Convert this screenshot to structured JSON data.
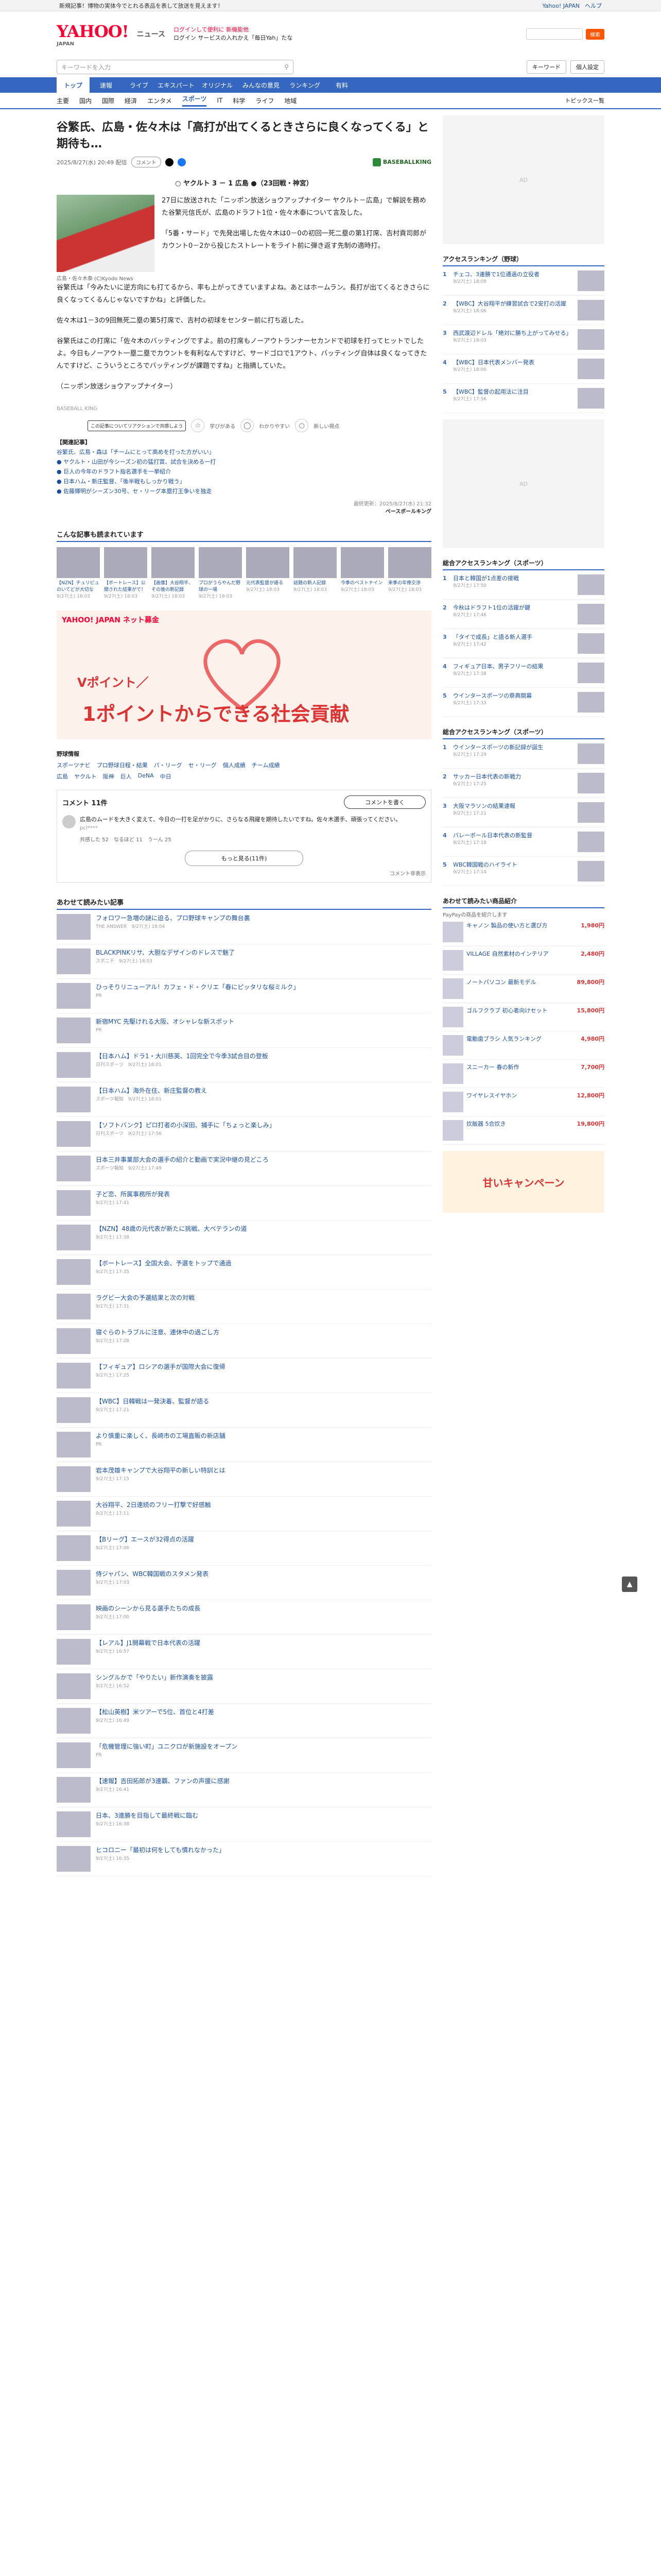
{
  "topstrip": {
    "promo": "新規記事！博物の実体今でとれる表品を表して放送を見えます！",
    "links": [
      "Yahoo! JAPAN",
      "ヘルプ"
    ]
  },
  "header": {
    "logo": "YAHOO!",
    "logo_sub": "JAPAN",
    "service": "ニュース",
    "lines": [
      "ログインして便利に 新機能他",
      "ログイン サービスの入れかえ「毎日Yah」たな"
    ],
    "search_btn": "検索"
  },
  "search": {
    "placeholder": "キーワードを入力",
    "right": [
      "キーワード",
      "個人設定"
    ]
  },
  "nav": [
    "トップ",
    "速報",
    "ライブ",
    "エキスパート",
    "オリジナル",
    "みんなの意見",
    "ランキング",
    "有料"
  ],
  "nav_on": "トップ",
  "subnav": [
    "主要",
    "国内",
    "国際",
    "経済",
    "エンタメ",
    "スポーツ",
    "IT",
    "科学",
    "ライフ",
    "地域"
  ],
  "subnav_on": "スポーツ",
  "subnav_topics": "トピックス一覧",
  "article": {
    "title": "谷繁氏、広島・佐々木は「高打が出てくるときさらに良くなってくる」と期待も…",
    "date": "2025/8/27(水) 20:49 配信",
    "comments_btn": "コメント",
    "brand": "BASEBALLKING",
    "lead": "○ ヤクルト 3 － 1 広島 ●（23回戦・神宮）",
    "caption": "広島・佐々木泰 (C)Kyodo News",
    "paragraphs": [
      "27日に放送された「ニッポン放送ショウアップナイター ヤクルト－広島」で解説を務めた谷繁元信氏が、広島のドラフト1位・佐々木泰について言及した。",
      "「5番・サード」で先発出場した佐々木は0－0の初回一死二塁の第1打席、吉村貢司郎がカウント0－2から投じたストレートをライト前に弾き返す先制の適時打。",
      "谷繁氏は「今みたいに逆方向にも打てるから、率も上がってきていますよね。あとはホームラン。長打が出てくるときさらに良くなってくるんじゃないですかね」と評価した。",
      "佐々木は1－3の9回無死二塁の第5打席で、吉村の初球をセンター前に打ち返した。",
      "谷繁氏はこの打席に「佐々木のバッティングですよ。前の打席もノーアウトランナーセカンドで初球を打ってヒットでしたよ。今日もノーアウト一塁二塁でカウントを有利なんですけど、サードゴロで1アウト、バッティング自体は良くなってきたんですけど、こういうところでバッティングが課題ですね」と指摘していた。"
    ],
    "source": "（ニッポン放送ショウアップナイター）",
    "provider": "BASEBALL KING",
    "tip": "この記事についてリアクションで共感しよう",
    "reactions": [
      "学びがある",
      "わかりやすい",
      "新しい視点"
    ],
    "related_hd": "【関連記事】",
    "related": [
      "谷繁氏、広島・森は「チームにとって高めを打った方がいい」",
      "● ヤクルト・山田が今シーズン初の猛打賞、試合を決める一打",
      "● 巨人の今年のドラフト指名選手を一挙紹介",
      "● 日本ハム・新庄監督、「後半戦もしっかり戦う」",
      "● 佐藤輝明がシーズン30号、セ・リーグ本塁打王争いを独走"
    ],
    "credit_date": "最終更新：2025/8/27(水) 21:32",
    "credit_name": "ベースボールキング"
  },
  "recommend": {
    "title": "こんな記事も読まれています",
    "cards": [
      {
        "t": "【NZN】チュリピュのいてどが大切な",
        "s": "9/27(土) 18:03"
      },
      {
        "t": "【ボートレース】公開された結果がで！",
        "s": "9/27(土) 18:03"
      },
      {
        "t": "【画像】大谷翔平、その後の新記録",
        "s": "9/27(土) 18:03"
      },
      {
        "t": "プロがうらやんだ野球の一場",
        "s": "9/27(土) 18:03"
      },
      {
        "t": "元代表監督が語る",
        "s": "9/27(土) 18:03"
      },
      {
        "t": "話題の新人記録",
        "s": "9/27(土) 18:03"
      },
      {
        "t": "今季のベストナイン",
        "s": "9/27(土) 18:03"
      },
      {
        "t": "来季の年俸交渉",
        "s": "9/27(土) 18:03"
      }
    ]
  },
  "banner": {
    "top": "YAHOO! JAPAN ネット募金",
    "line1": "Vポイント／",
    "line2": "1ポイントからできる社会貢献"
  },
  "schedule": {
    "title": "野球情報",
    "row1": [
      "スポーツナビ",
      "プロ野球日程・結果",
      "パ・リーグ",
      "セ・リーグ",
      "個人成績",
      "チーム成績"
    ],
    "row2": [
      "広島",
      "ヤクルト",
      "阪神",
      "巨人",
      "DeNA",
      "中日"
    ]
  },
  "comments": {
    "title": "コメント 11件",
    "write": "コメントを書く",
    "first": "広島のムードを大きく変えて、今日の一打を足がかりに、さらなる飛躍を期待したいですね。佐々木選手、頑張ってください。",
    "first_user": "pcl****",
    "votes": [
      "共感した 52",
      "なるほど 11",
      "うーん 25"
    ],
    "more": "もっと見る(11件)",
    "note": "コメント非表示"
  },
  "feed_title": "あわせて読みたい記事",
  "feed": [
    {
      "t": "フォロワー急増の謎に迫る、プロ野球キャンプの舞台裏",
      "s": "THE ANSWER　9/27(土) 18:04"
    },
    {
      "t": "BLACKPINKリサ、大胆なデザインのドレスで魅了",
      "s": "スポニチ　9/27(土) 18:03"
    },
    {
      "t": "ひっそりリニューアル！カフェ・ド・クリエ「春にピッタリな桜ミルク」",
      "s": "PR"
    },
    {
      "t": "新宿MYC 先駆けれる大阪、オシャレな新スポット",
      "s": "PR"
    },
    {
      "t": "【日本ハム】ドラ1・大川慈英、1回完全で今季3試合目の登板",
      "s": "日刊スポーツ　9/27(土) 18:01"
    },
    {
      "t": "【日本ハム】海外在住、新庄監督の教え",
      "s": "スポーツ報知　9/27(土) 18:01"
    },
    {
      "t": "【ソフトバンク】ピロ打者の小深田、捕手に「ちょっと楽しみ」",
      "s": "日刊スポーツ　9/27(土) 17:56"
    },
    {
      "t": "日本三井事業部大会の選手の紹介と動画で実況中継の見どころ",
      "s": "スポーツ報知　9/27(土) 17:49"
    },
    {
      "t": "子ど恋、所属事務所が発表",
      "s": "9/27(土) 17:41"
    },
    {
      "t": "【NZN】48歳の元代表が新たに挑戦、大ベテランの道",
      "s": "9/27(土) 17:38"
    },
    {
      "t": "【ボートレース】全国大会、予選をトップで通過",
      "s": "9/27(土) 17:35"
    },
    {
      "t": "ラグビー大会の予選結果と次の対戦",
      "s": "9/27(土) 17:31"
    },
    {
      "t": "寝ぐらのトラブルに注意、連休中の過ごし方",
      "s": "9/27(土) 17:28"
    },
    {
      "t": "【フィギュア】ロシアの選手が国際大会に復帰",
      "s": "9/27(土) 17:25"
    },
    {
      "t": "【WBC】日韓戦は一発決着、監督が語る",
      "s": "9/27(土) 17:21"
    },
    {
      "t": "より慎重に楽しく、長崎市の工場直販の新店舗",
      "s": "PR"
    },
    {
      "t": "岩本茂雄キャンプで大谷翔平の新しい特訓とは",
      "s": "9/27(土) 17:15"
    },
    {
      "t": "大谷翔平、2日連続のフリー打撃で好感触",
      "s": "9/27(土) 17:11"
    },
    {
      "t": "【Bリーグ】エースが32得点の活躍",
      "s": "9/27(土) 17:06"
    },
    {
      "t": "侍ジャパン、WBC韓国戦のスタメン発表",
      "s": "9/27(土) 17:03"
    },
    {
      "t": "映画のシーンから見る選手たちの成長",
      "s": "9/27(土) 17:00"
    },
    {
      "t": "【レアル】J1開幕戦で日本代表の活躍",
      "s": "9/27(土) 16:57"
    },
    {
      "t": "シングルかで「やりたい」新作演奏を披露",
      "s": "9/27(土) 16:52"
    },
    {
      "t": "【松山英樹】米ツアーで5位、首位と4打差",
      "s": "9/27(土) 16:49"
    },
    {
      "t": "「危機管理に強い町」ユニクロが新施設をオープン",
      "s": "PR"
    },
    {
      "t": "【速報】吉田拓郎が3連覇、ファンの声援に感謝",
      "s": "9/27(土) 16:41"
    },
    {
      "t": "日本、3連勝を目指して最終戦に臨む",
      "s": "9/27(土) 16:38"
    },
    {
      "t": "ヒコロニー「最初は何をしても慣れなかった」",
      "s": "9/27(土) 16:35"
    }
  ],
  "side": {
    "rank_title": "アクセスランキング（野球）",
    "rank": [
      {
        "t": "チェコ、3連勝で1位通過の立役者",
        "s": "9/27(土) 18:09"
      },
      {
        "t": "【WBC】大谷翔平が練習試合で2安打の活躍",
        "s": "9/27(土) 18:06"
      },
      {
        "t": "西武渡辺ドレル「絶対に勝ち上がってみせる」",
        "s": "9/27(土) 18:03"
      },
      {
        "t": "【WBC】日本代表メンバー発表",
        "s": "9/27(土) 18:00"
      },
      {
        "t": "【WBC】監督の起用法に注目",
        "s": "9/27(土) 17:56"
      }
    ],
    "rank2_title": "総合アクセスランキング（スポーツ）",
    "rank2": [
      {
        "t": "日本と韓国が1点差の接戦",
        "s": "9/27(土) 17:50"
      },
      {
        "t": "今秋はドラフト1位の活躍が鍵",
        "s": "9/27(土) 17:46"
      },
      {
        "t": "「タイで成長」と語る新人選手",
        "s": "9/27(土) 17:42"
      },
      {
        "t": "フィギュア日本、男子フリーの結果",
        "s": "9/27(土) 17:38"
      },
      {
        "t": "ウインタースポーツの祭典開幕",
        "s": "9/27(土) 17:33"
      }
    ],
    "rank3_title": "総合アクセスランキング（スポーツ）",
    "rank3": [
      {
        "t": "ウインタースポーツの新記録が誕生",
        "s": "9/27(土) 17:29"
      },
      {
        "t": "サッカー日本代表の新戦力",
        "s": "9/27(土) 17:25"
      },
      {
        "t": "大阪マラソンの結果速報",
        "s": "9/27(土) 17:21"
      },
      {
        "t": "バレーボール日本代表の新監督",
        "s": "9/27(土) 17:18"
      },
      {
        "t": "WBC韓国戦のハイライト",
        "s": "9/27(土) 17:14"
      }
    ],
    "shop_title": "あわせて読みたい商品紹介",
    "shop_sub": "PayPayの商品を紹介します",
    "shop": [
      {
        "t": "キャノン 製品の使い方と選び方",
        "p": "1,980円"
      },
      {
        "t": "VILLAGE 自然素材のインテリア",
        "p": "2,480円"
      },
      {
        "t": "ノートパソコン 最新モデル",
        "p": "89,800円"
      },
      {
        "t": "ゴルフクラブ 初心者向けセット",
        "p": "15,800円"
      },
      {
        "t": "電動歯ブラシ 人気ランキング",
        "p": "4,980円"
      },
      {
        "t": "スニーカー 春の新作",
        "p": "7,700円"
      },
      {
        "t": "ワイヤレスイヤホン",
        "p": "12,800円"
      },
      {
        "t": "炊飯器 5合炊き",
        "p": "19,800円"
      }
    ],
    "bigad": "甘いキャンペーン"
  }
}
